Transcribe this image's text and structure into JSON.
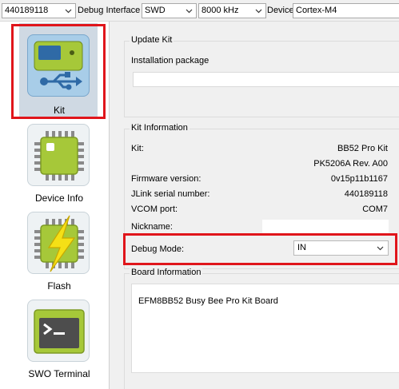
{
  "toolbar": {
    "serial_value": "440189118",
    "debug_interface_label": "Debug Interface",
    "debug_interface_value": "SWD",
    "speed_value": "8000 kHz",
    "device_label": "Device",
    "device_value": "Cortex-M4"
  },
  "sidebar": {
    "items": [
      {
        "label": "Kit",
        "icon": "kit-board-usb-icon",
        "selected": true
      },
      {
        "label": "Device Info",
        "icon": "chip-icon"
      },
      {
        "label": "Flash",
        "icon": "flash-chip-icon"
      },
      {
        "label": "SWO Terminal",
        "icon": "terminal-icon"
      }
    ]
  },
  "update_kit": {
    "title": "Update Kit",
    "installation_label": "Installation package",
    "installation_value": ""
  },
  "kit_info": {
    "title": "Kit Information",
    "kit_label": "Kit:",
    "kit_value": "BB52 Pro Kit",
    "kit_part": "PK5206A Rev. A00",
    "firmware_label": "Firmware version:",
    "firmware_value": "0v15p11b1167",
    "jlink_label": "JLink serial number:",
    "jlink_value": "440189118",
    "vcom_label": "VCOM port:",
    "vcom_value": "COM7",
    "nickname_label": "Nickname:",
    "nickname_value": "",
    "debug_mode_label": "Debug Mode:",
    "debug_mode_value": "IN"
  },
  "board_info": {
    "title": "Board Information",
    "board_name": "EFM8BB52 Busy Bee Pro Kit Board"
  },
  "colors": {
    "highlight_red": "#e0151b",
    "selected_bg": "#cfd9e3",
    "icon_green": "#a6c839",
    "icon_blue": "#2f6aa6"
  }
}
